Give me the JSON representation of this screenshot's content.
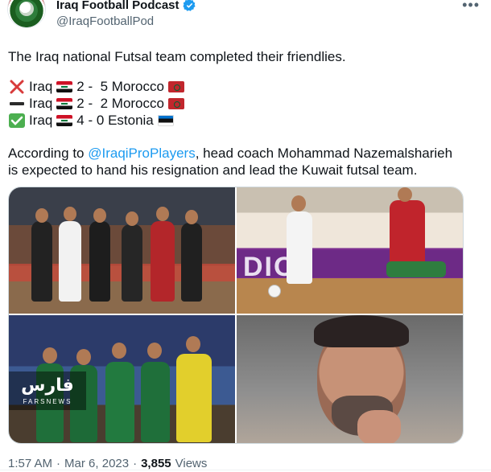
{
  "author": {
    "display_name": "Iraq Football Podcast",
    "handle": "@IraqFootballPod"
  },
  "tweet": {
    "line1": "The Iraq national Futsal team completed their friendlies.",
    "results": [
      {
        "mark": "cross-mark-icon",
        "team": "Iraq",
        "score": "2 -  5",
        "opponent": "Morocco",
        "opp_flag": "morocco-flag-icon"
      },
      {
        "mark": "dash-icon",
        "team": "Iraq",
        "score": "2 -  2",
        "opponent": "Morocco",
        "opp_flag": "morocco-flag-icon"
      },
      {
        "mark": "check-mark-icon",
        "team": "Iraq",
        "score": "4 - 0",
        "opponent": "Estonia",
        "opp_flag": "estonia-flag-icon"
      }
    ],
    "para_prefix": "According to ",
    "mention": "@IraqiProPlayers",
    "para_suffix_line1": ", head coach Mohammad Nazemalsharieh",
    "para_line2": "is expected to hand his resignation and lead the Kuwait futsal team."
  },
  "media": {
    "tile2_banner_text": "DIOn",
    "watermark_arabic": "فارس",
    "watermark_latin": "FARSNEWS"
  },
  "meta": {
    "time": "1:57 AM",
    "separator": "·",
    "date": "Mar 6, 2023",
    "views_count": "3,855",
    "views_label": "Views"
  },
  "colors": {
    "link": "#1d9bf0",
    "secondary_text": "#536471",
    "verified": "#1d9bf0"
  }
}
